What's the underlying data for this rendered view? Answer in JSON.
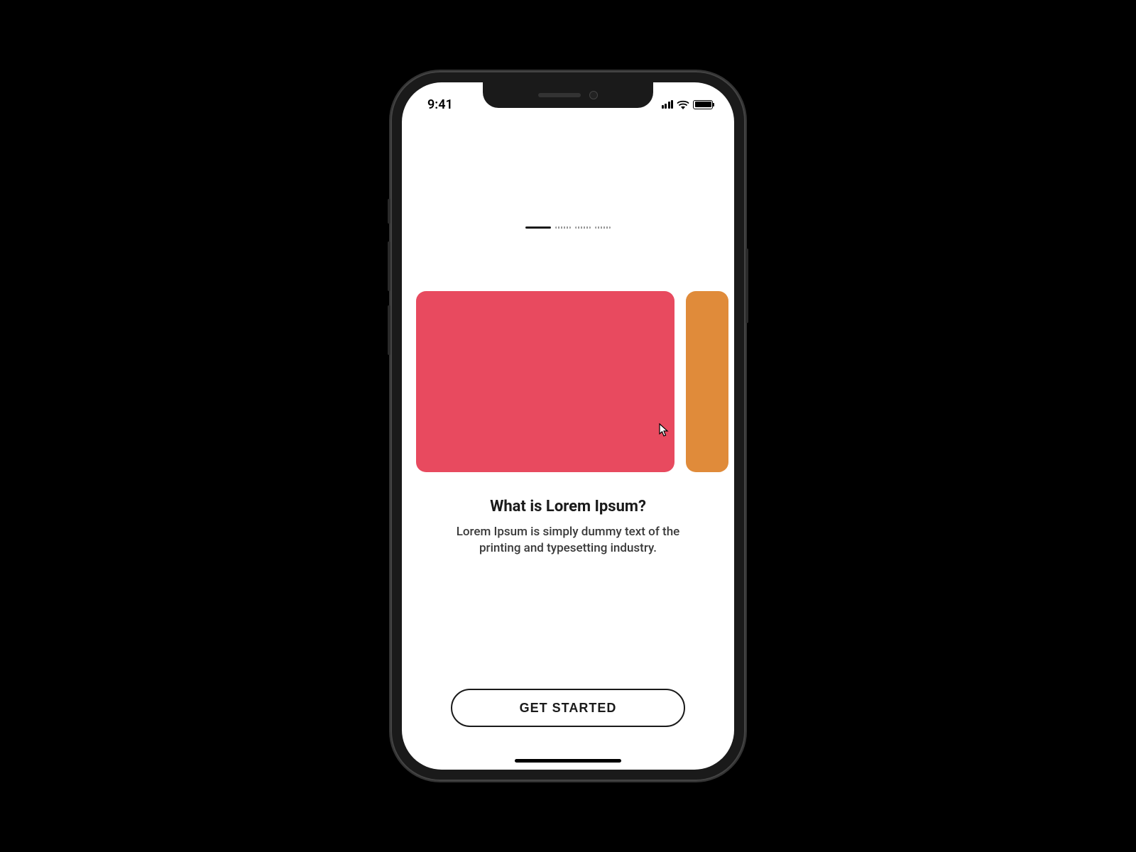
{
  "status_bar": {
    "time": "9:41"
  },
  "pagination": {
    "total": 4,
    "active_index": 0
  },
  "carousel": {
    "cards": [
      {
        "color": "#e84a5f"
      },
      {
        "color": "#e08b3a"
      }
    ]
  },
  "onboarding": {
    "title": "What is Lorem Ipsum?",
    "body": "Lorem Ipsum is simply dummy text of the printing and typesetting industry."
  },
  "cta": {
    "label": "GET STARTED"
  }
}
